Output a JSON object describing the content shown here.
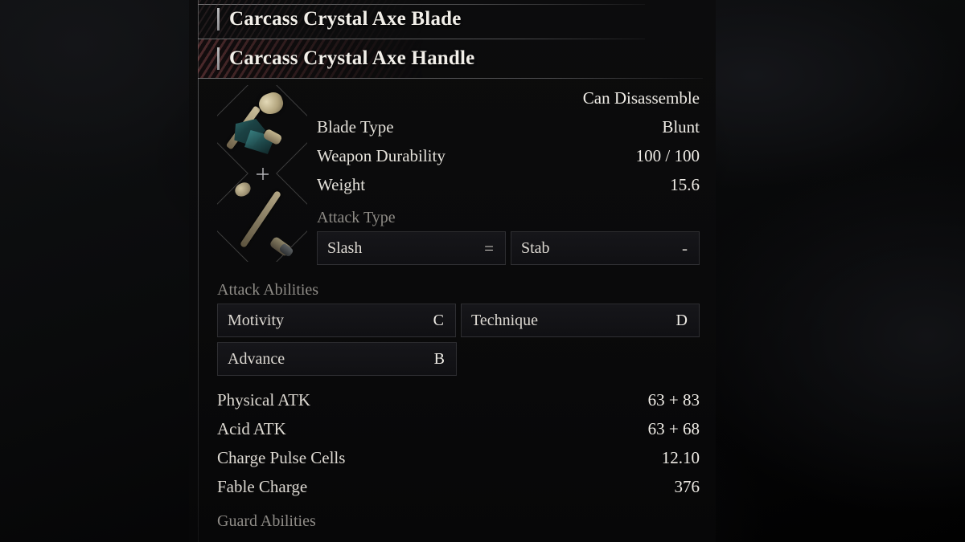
{
  "panel": {
    "titles": [
      {
        "label": "Carcass Crystal Axe Blade",
        "accent": "#b9b9bb"
      },
      {
        "label": "Carcass Crystal Axe Handle",
        "accent": "#b9b9bb"
      }
    ],
    "icons": {
      "blade_slot": "axe-blade-icon",
      "handle_slot": "axe-handle-icon",
      "combine_symbol": "plus-icon"
    },
    "header_stats": {
      "disassemble_status": "Can Disassemble",
      "rows": [
        {
          "key": "Blade Type",
          "value": "Blunt"
        },
        {
          "key": "Weapon Durability",
          "value": "100 / 100"
        },
        {
          "key": "Weight",
          "value": "15.6"
        }
      ]
    },
    "attack_type": {
      "heading": "Attack Type",
      "entries": [
        {
          "label": "Slash",
          "value": "="
        },
        {
          "label": "Stab",
          "value": "-"
        }
      ]
    },
    "attack_abilities": {
      "heading": "Attack Abilities",
      "entries": [
        {
          "label": "Motivity",
          "value": "C"
        },
        {
          "label": "Technique",
          "value": "D"
        },
        {
          "label": "Advance",
          "value": "B"
        }
      ]
    },
    "derived_stats": [
      {
        "key": "Physical ATK",
        "value": "63 + 83"
      },
      {
        "key": "Acid ATK",
        "value": "63 + 68"
      },
      {
        "key": "Charge Pulse Cells",
        "value": "12.10"
      },
      {
        "key": "Fable Charge",
        "value": "376"
      }
    ],
    "guard_abilities": {
      "heading": "Guard Abilities"
    }
  },
  "colors": {
    "panel_bg": "#0a0a0b",
    "text_primary": "#efece6",
    "text_muted": "#8e8b86",
    "accent_hatch": "#80444 4",
    "box_border": "#8c8c91"
  }
}
